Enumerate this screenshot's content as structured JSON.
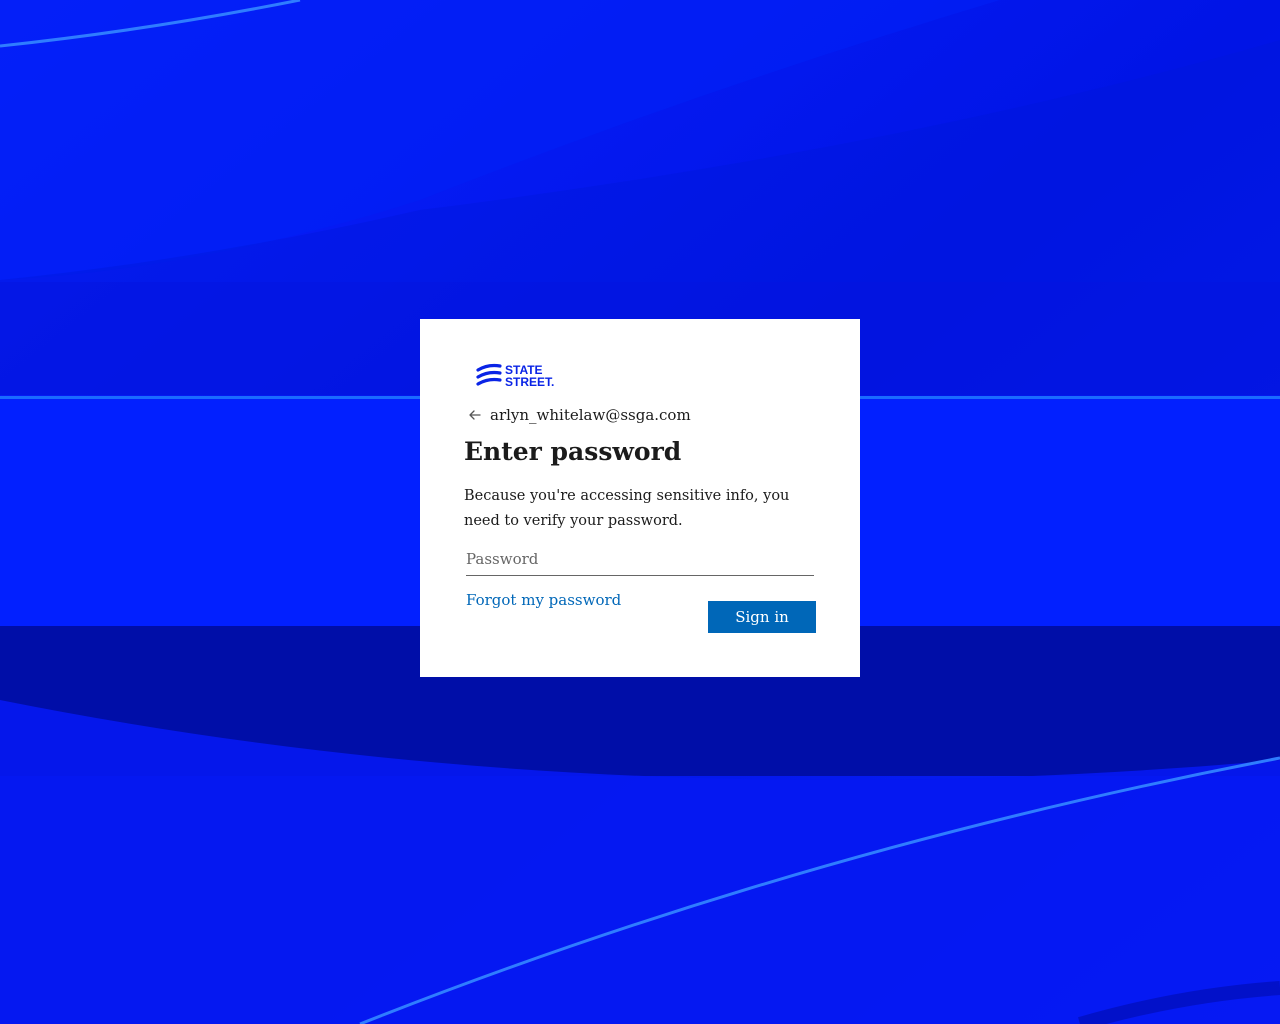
{
  "colors": {
    "background": "#0a16f0",
    "card": "#ffffff",
    "accent": "#0067b8",
    "logo": "#0a24e6",
    "text": "#1b1b1b"
  },
  "logo": {
    "line1": "STATE",
    "line2": "STREET."
  },
  "identity": {
    "back_icon": "arrow-left-icon",
    "email": "arlyn_whitelaw@ssga.com"
  },
  "heading": "Enter password",
  "description": "Because you're accessing sensitive info, you need to verify your password.",
  "password_field": {
    "placeholder": "Password",
    "value": ""
  },
  "forgot_link": "Forgot my password",
  "sign_in_button": "Sign in"
}
